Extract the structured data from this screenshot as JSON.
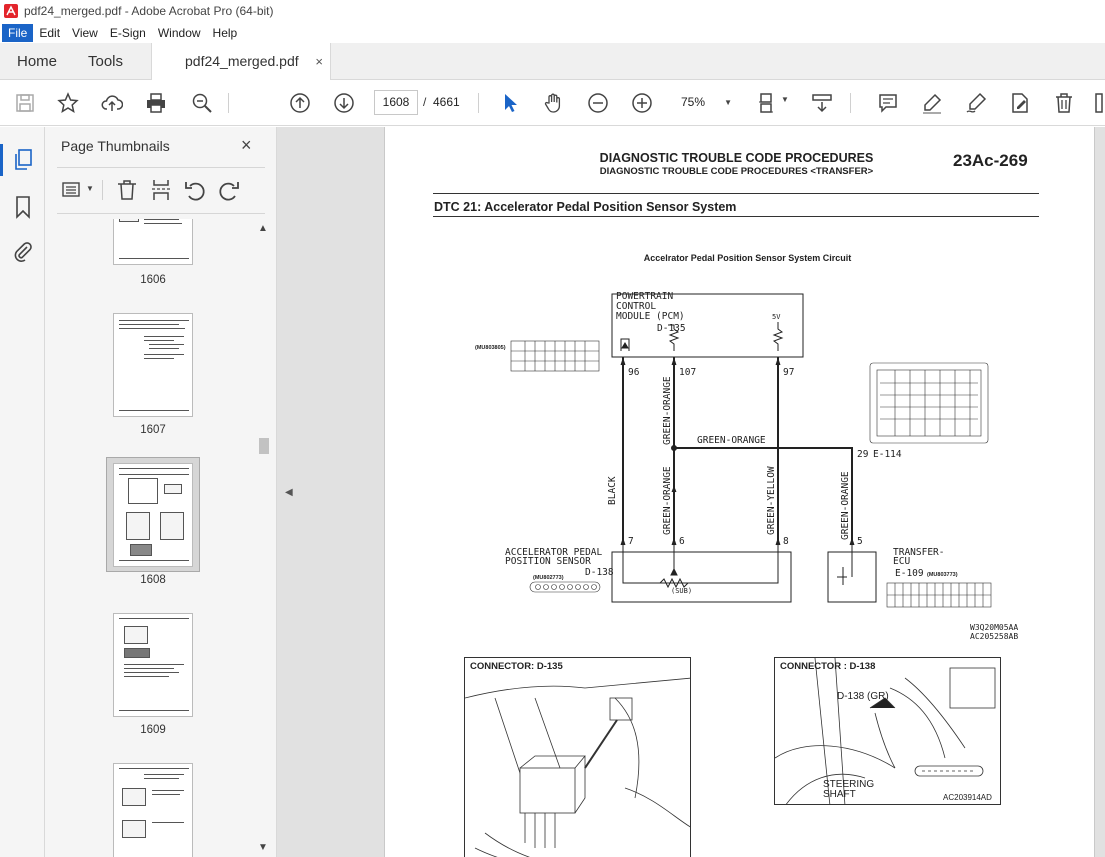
{
  "window": {
    "title": "pdf24_merged.pdf - Adobe Acrobat Pro (64-bit)"
  },
  "menu": [
    "File",
    "Edit",
    "View",
    "E-Sign",
    "Window",
    "Help"
  ],
  "tabs": {
    "home": "Home",
    "tools": "Tools",
    "document": "pdf24_merged.pdf",
    "close": "×"
  },
  "toolbar": {
    "current_page": "1608",
    "separator": "/",
    "total_pages": "4661",
    "zoom": "75%"
  },
  "thumbnails": {
    "title": "Page Thumbnails",
    "close": "×",
    "pages": [
      "1606",
      "1607",
      "1608",
      "1609"
    ],
    "selected": "1608"
  },
  "page": {
    "header1": "DIAGNOSTIC TROUBLE CODE PROCEDURES",
    "header2": "DIAGNOSTIC TROUBLE CODE PROCEDURES <TRANSFER>",
    "page_number": "23Ac-269",
    "dtc_title": "DTC 21: Accelerator Pedal Position Sensor System",
    "circuit_title": "Accelrator Pedal Position Sensor System Circuit",
    "pcm": {
      "line1": "POWERTRAIN",
      "line2": "CONTROL",
      "line3": "MODULE (PCM)",
      "id": "D-135",
      "part": "(MU803805)",
      "v5": "5V"
    },
    "pins": {
      "p96": "96",
      "p107": "107",
      "p97": "97",
      "p7": "7",
      "p6": "6",
      "p8": "8",
      "p5": "5",
      "p29": "29"
    },
    "wires": {
      "black": "BLACK",
      "green_orange": "GREEN-ORANGE",
      "green_yellow": "GREEN-YELLOW"
    },
    "junction": "E-114",
    "apps": {
      "line1": "ACCELERATOR PEDAL",
      "line2": "POSITION SENSOR",
      "id": "D-138",
      "part": "(MU802773)",
      "sub": "(SUB)"
    },
    "tecu": {
      "line1": "TRANSFER-",
      "line2": "ECU",
      "id": "E-109",
      "part": "(MU803773)"
    },
    "refs": {
      "r1": "W3Q20M05AA",
      "r2": "AC205258AB"
    },
    "connector1": {
      "label": "CONNECTOR: D-135"
    },
    "connector2": {
      "label": "CONNECTOR : D-138",
      "callout": "D-138 (GR)",
      "steering": "STEERING",
      "shaft": "SHAFT",
      "ref": "AC203914AD"
    }
  }
}
